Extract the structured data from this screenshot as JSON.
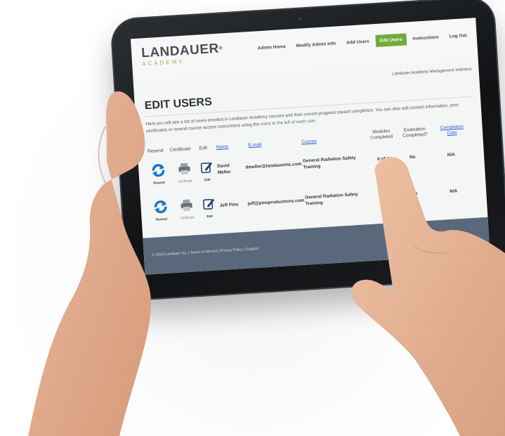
{
  "brand": {
    "name": "LANDAUER",
    "reg": "®",
    "sub": "ACADEMY"
  },
  "nav": [
    {
      "label": "Admin Home",
      "active": false
    },
    {
      "label": "Modify Admin Info",
      "active": false
    },
    {
      "label": "Add Users",
      "active": false
    },
    {
      "label": "Edit Users",
      "active": true
    },
    {
      "label": "Instructions",
      "active": false
    },
    {
      "label": "Log Out",
      "active": false
    }
  ],
  "management_label": "Landauer Academy Management Interface",
  "page_title": "EDIT USERS",
  "intro": {
    "line1": "Here you will see a list of users enrolled in Landauer Academy courses and their current progress toward completion. You can also edit contact",
    "line2_start": "information, print certificates or resend course access instructions using the",
    "line2_link": "icons to the left of each user."
  },
  "table": {
    "headers": {
      "resend": "Resend",
      "certificate": "Certificate",
      "edit": "Edit",
      "name": "Name",
      "email": "E-mail",
      "course": "Course",
      "modules_1": "Modules",
      "modules_2": "Completed",
      "evaluation_1": "Evaluation",
      "evaluation_2": "Completed?",
      "completion_1": "Completion",
      "completion_2": "Date"
    },
    "icon_labels": {
      "resend": "Resend",
      "certificate": "Certificate",
      "edit": "Edit"
    },
    "rows": [
      {
        "name_1": "David",
        "name_2": "Mellor",
        "email": "dmellor@landauerinc.com",
        "course_1": "General Radiation Safety",
        "course_2": "Training",
        "modules": "0 of 1",
        "evaluation": "No",
        "completion": "N/A"
      },
      {
        "name_1": "Jeff Pins",
        "name_2": "",
        "email": "jeff@pinsproductions.com",
        "course_1": "General Radiation Safety",
        "course_2": "Training",
        "modules": "",
        "evaluation": "No",
        "completion": "N/A"
      }
    ]
  },
  "footer": "© 2015 Landauer Inc. | Terms of Service | Privacy Policy | Support",
  "colors": {
    "accent_green": "#6fac3b",
    "link_blue": "#2a5bd7",
    "footer_bg": "#59697b",
    "resend_blue": "#1a77c9"
  }
}
